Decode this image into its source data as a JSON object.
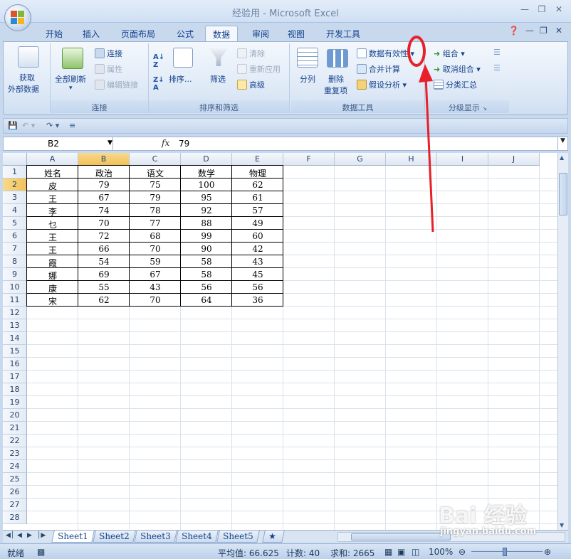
{
  "window": {
    "title": "经验用 - Microsoft Excel"
  },
  "ribbon_tabs": [
    {
      "label": "开始",
      "active": false
    },
    {
      "label": "插入",
      "active": false
    },
    {
      "label": "页面布局",
      "active": false
    },
    {
      "label": "公式",
      "active": false
    },
    {
      "label": "数据",
      "active": true
    },
    {
      "label": "审阅",
      "active": false
    },
    {
      "label": "视图",
      "active": false
    },
    {
      "label": "开发工具",
      "active": false
    }
  ],
  "ribbon": {
    "get_external": {
      "label": "获取",
      "label2": "外部数据"
    },
    "connections": {
      "refresh_all": "全部刷新",
      "connections": "连接",
      "properties": "属性",
      "edit_links": "编辑链接",
      "group_label": "连接"
    },
    "sort_filter": {
      "sort": "排序...",
      "filter": "筛选",
      "clear": "清除",
      "reapply": "重新应用",
      "advanced": "高级",
      "group_label": "排序和筛选"
    },
    "data_tools": {
      "text_to_columns": "分列",
      "remove_duplicates": "删除",
      "remove_duplicates2": "重复项",
      "data_validation": "数据有效性",
      "consolidate": "合并计算",
      "what_if": "假设分析",
      "group_label": "数据工具"
    },
    "outline": {
      "group": "组合",
      "ungroup": "取消组合",
      "subtotal": "分类汇总",
      "group_label": "分级显示"
    }
  },
  "formula_bar": {
    "name_box": "B2",
    "fx": "fx",
    "value": "79"
  },
  "columns": [
    "A",
    "B",
    "C",
    "D",
    "E",
    "F",
    "G",
    "H",
    "I",
    "J"
  ],
  "rows": [
    "1",
    "2",
    "3",
    "4",
    "5",
    "6",
    "7",
    "8",
    "9",
    "10",
    "11",
    "12",
    "13",
    "14",
    "15",
    "16",
    "17",
    "18",
    "19",
    "20",
    "21",
    "22",
    "23",
    "24",
    "25",
    "26",
    "27",
    "28"
  ],
  "table": {
    "header": [
      "姓名",
      "政治",
      "语文",
      "数学",
      "物理"
    ],
    "rows": [
      [
        "皮",
        "79",
        "75",
        "100",
        "62"
      ],
      [
        "王",
        "67",
        "79",
        "95",
        "61"
      ],
      [
        "李",
        "74",
        "78",
        "92",
        "57"
      ],
      [
        "乜",
        "70",
        "77",
        "88",
        "49"
      ],
      [
        "王",
        "72",
        "68",
        "99",
        "60"
      ],
      [
        "王",
        "66",
        "70",
        "90",
        "42"
      ],
      [
        "霞",
        "54",
        "59",
        "58",
        "43"
      ],
      [
        "娜",
        "69",
        "67",
        "58",
        "45"
      ],
      [
        "康",
        "55",
        "43",
        "56",
        "56"
      ],
      [
        "宋",
        "62",
        "70",
        "64",
        "36"
      ]
    ]
  },
  "sheets": [
    {
      "label": "Sheet1",
      "active": true
    },
    {
      "label": "Sheet2",
      "active": false
    },
    {
      "label": "Sheet3",
      "active": false
    },
    {
      "label": "Sheet4",
      "active": false
    },
    {
      "label": "Sheet5",
      "active": false
    }
  ],
  "status": {
    "ready": "就绪",
    "average": "平均值: 66.625",
    "count": "计数: 40",
    "sum": "求和: 2665",
    "zoom": "100%"
  },
  "watermark": {
    "text": "jingyan.baidu.com",
    "logo": "Bai 经验"
  },
  "colors": {
    "annotation": "#e8202a",
    "accent": "#15428b"
  }
}
